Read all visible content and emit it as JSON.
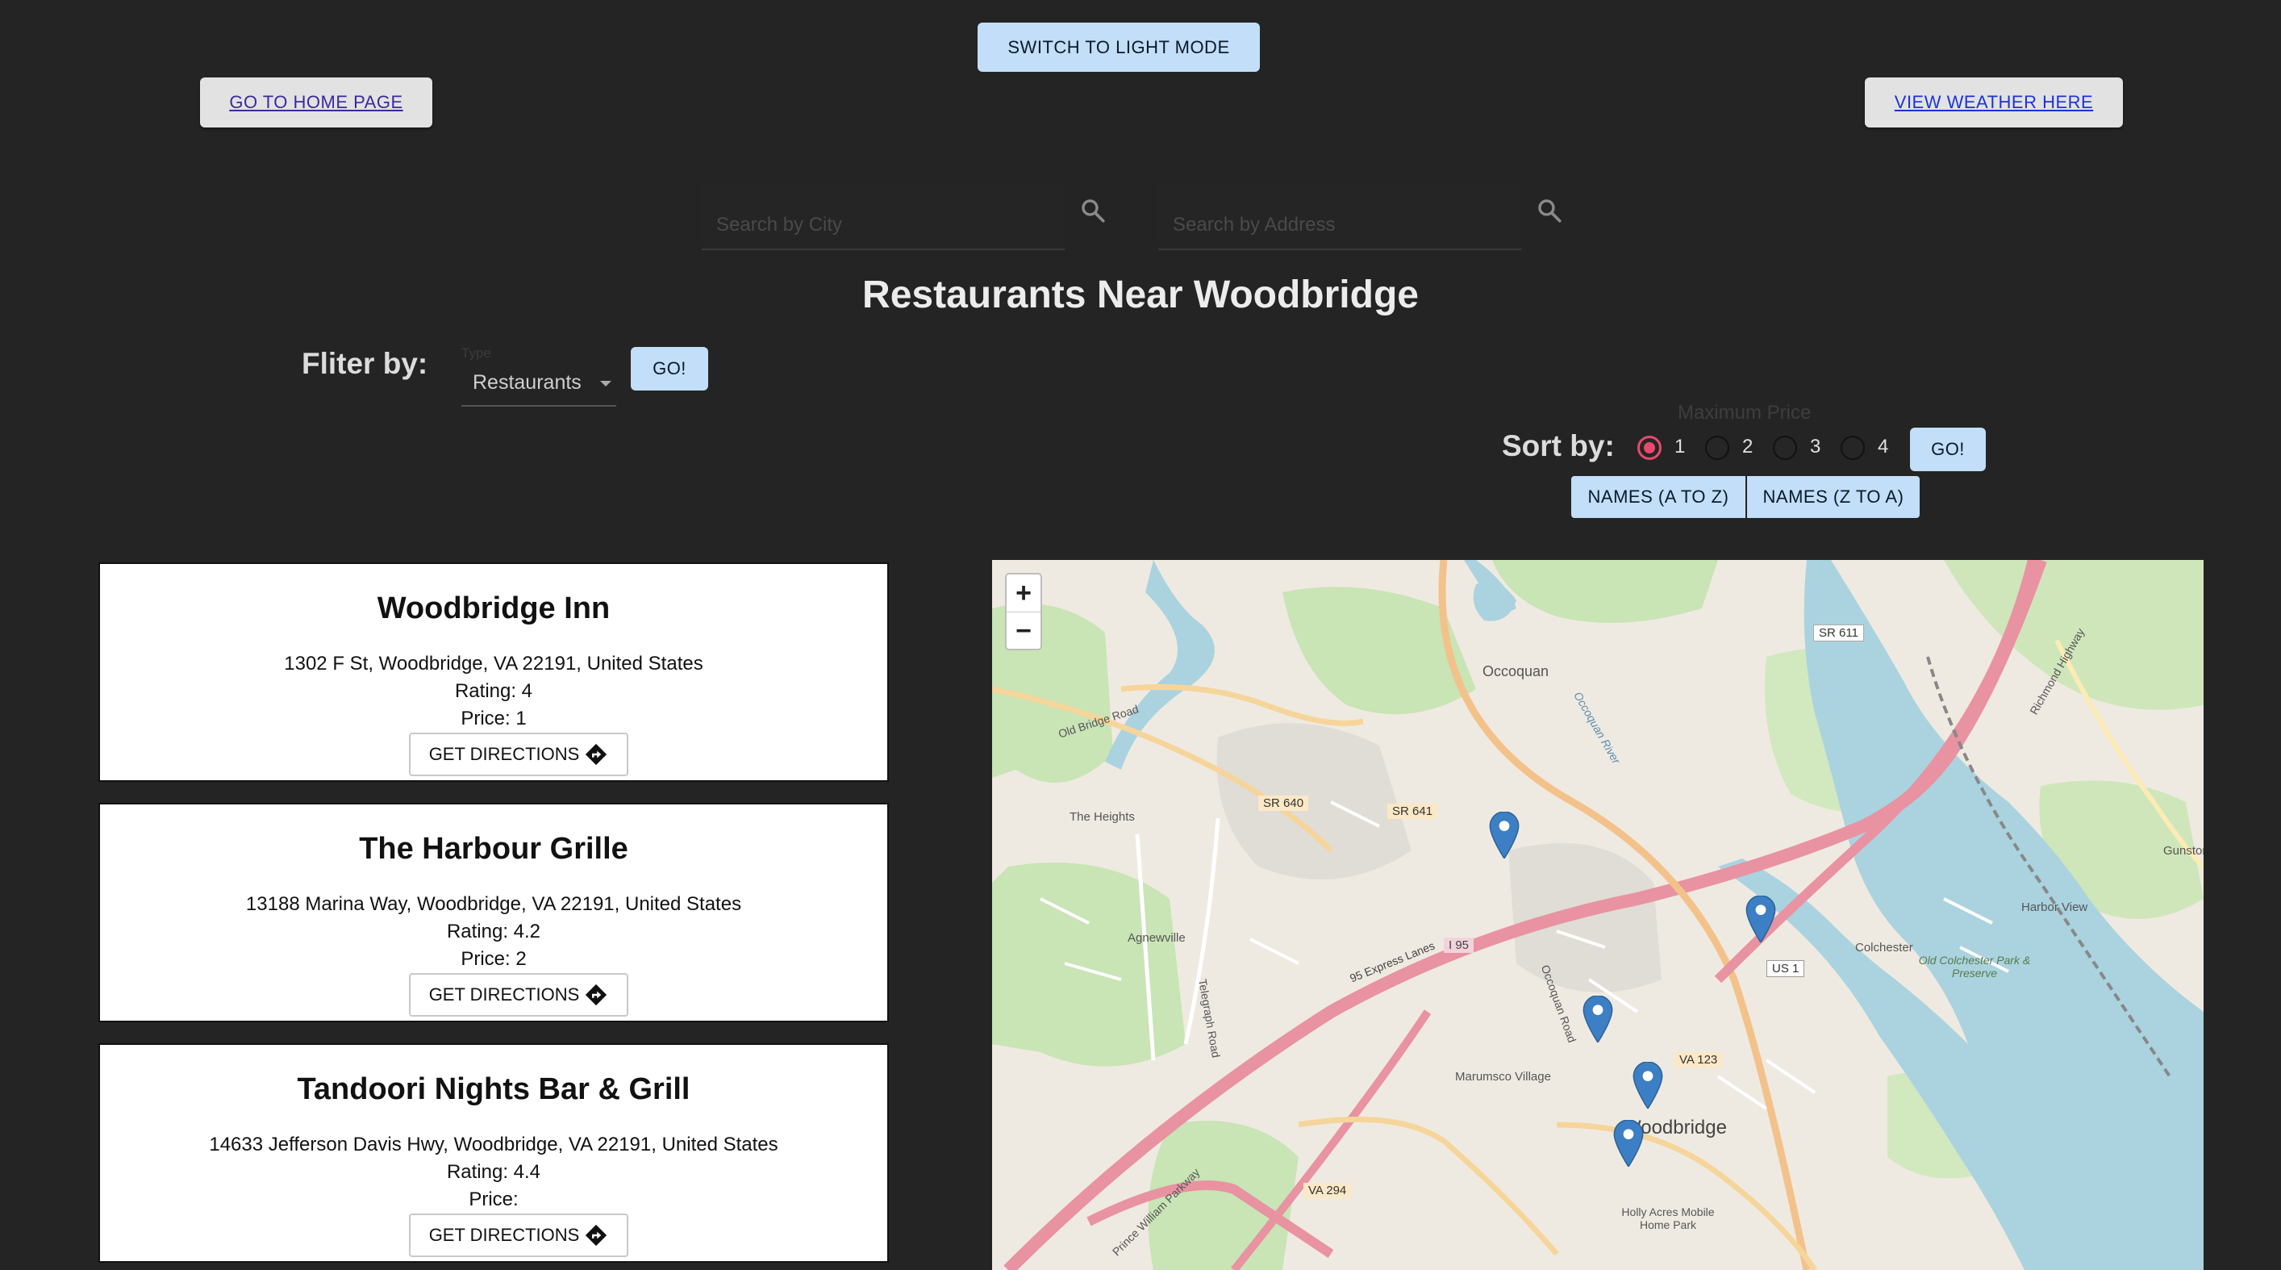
{
  "header": {
    "switch_mode_label": "SWITCH TO LIGHT MODE",
    "home_label": "GO TO HOME PAGE",
    "weather_label": "VIEW WEATHER HERE"
  },
  "search": {
    "city_placeholder": "Search by City",
    "address_placeholder": "Search by Address"
  },
  "page_title": "Restaurants Near Woodbridge",
  "filter": {
    "label": "Fliter by:",
    "type_caption": "Type",
    "type_value": "Restaurants",
    "go_label": "GO!"
  },
  "sort": {
    "label": "Sort by:",
    "max_price_caption": "Maximum Price",
    "price_options": [
      "1",
      "2",
      "3",
      "4"
    ],
    "selected_price": "1",
    "go_label": "GO!",
    "names_az_label": "NAMES (A TO Z)",
    "names_za_label": "NAMES (Z TO A)"
  },
  "restaurants": [
    {
      "name": "Woodbridge Inn",
      "address": "1302 F St, Woodbridge, VA 22191, United States",
      "rating": "Rating: 4",
      "price": "Price: 1",
      "directions_label": "GET DIRECTIONS"
    },
    {
      "name": "The Harbour Grille",
      "address": "13188 Marina Way, Woodbridge, VA 22191, United States",
      "rating": "Rating: 4.2",
      "price": "Price: 2",
      "directions_label": "GET DIRECTIONS"
    },
    {
      "name": "Tandoori Nights Bar & Grill",
      "address": "14633 Jefferson Davis Hwy, Woodbridge, VA 22191, United States",
      "rating": "Rating: 4.4",
      "price": "Price:",
      "directions_label": "GET DIRECTIONS"
    }
  ],
  "map": {
    "zoom_in": "+",
    "zoom_out": "−",
    "labels": {
      "occoquan": "Occoquan",
      "woodbridge": "Woodbridge",
      "the_heights": "The Heights",
      "agnewville": "Agnewville",
      "marumsco": "Marumsco Village",
      "colchester": "Colchester",
      "harbor_view": "Harbor View",
      "gunston": "Gunston",
      "old_colchester_park": "Old Colchester Park & Preserve",
      "holly_acres": "Holly Acres Mobile Home Park",
      "old_bridge_road": "Old Bridge Road",
      "express_lanes": "95 Express Lanes",
      "i95": "I 95",
      "us1": "US 1",
      "va123": "VA 123",
      "va294": "VA 294",
      "sr640": "SR 640",
      "sr641": "SR 641",
      "sr611": "SR 611",
      "prince_william_parkway": "Prince William Parkway",
      "occoquan_river": "Occoquan River",
      "occoquan_road": "Occoquan Road",
      "richmond_highway": "Richmond Highway",
      "telegraph_road": "Telegraph Road"
    },
    "marker_count": 5
  },
  "colors": {
    "background": "#242424",
    "accent_button": "#c2def8",
    "radio_selected": "#e8496c",
    "marker": "#3d7fc4"
  }
}
